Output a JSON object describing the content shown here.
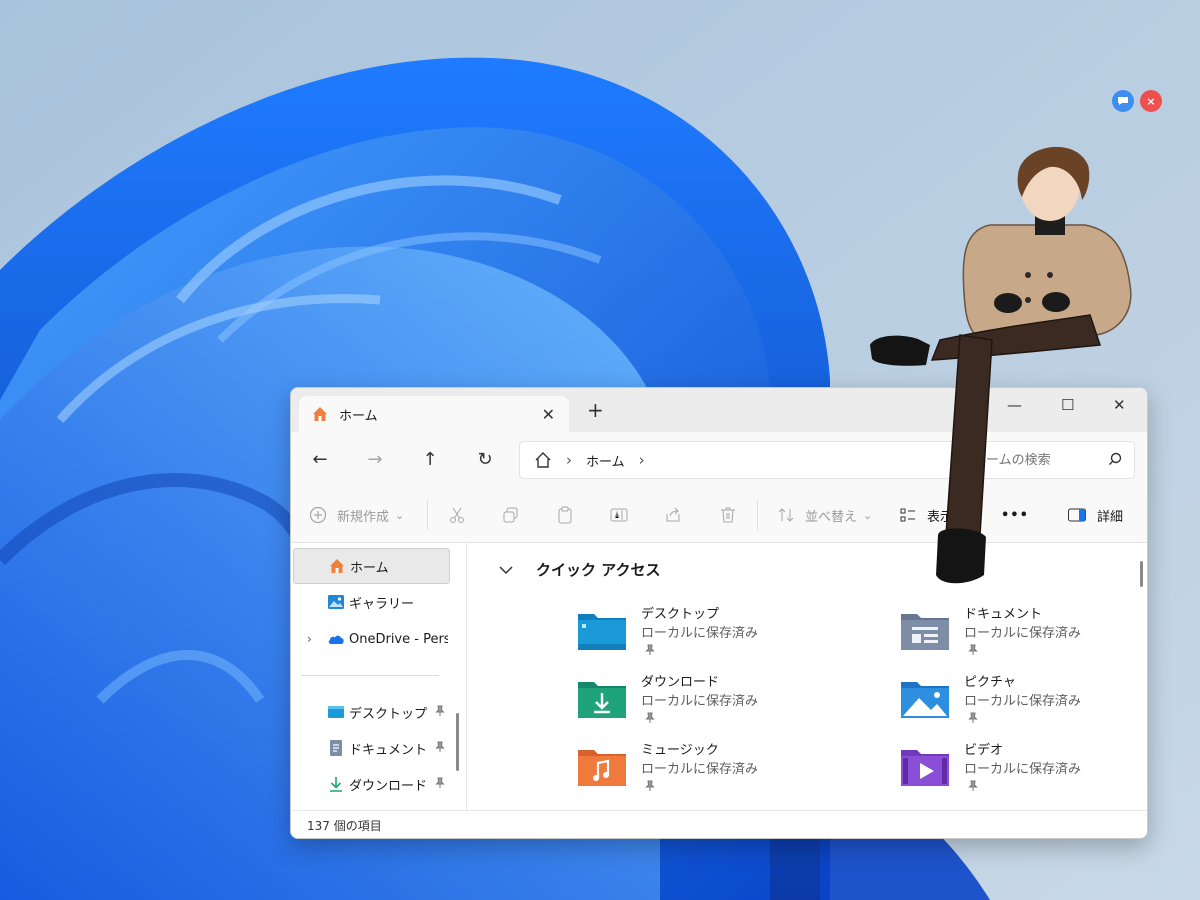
{
  "colors": {
    "accent_home": "#f0803c",
    "folder_blue": "#1a9bd7",
    "folder_green": "#1fa37a",
    "folder_orange": "#ef7a3c",
    "folder_purple": "#8a4fd6",
    "folder_gray": "#7d8ea6",
    "folder_sky": "#2e8fe0"
  },
  "mascot": {
    "chat_icon": "chat-bubble-icon",
    "close_glyph": "×"
  },
  "window": {
    "tab_title": "ホーム",
    "tab_close": "✕",
    "new_tab": "+",
    "minimize": "—",
    "maximize": "☐",
    "close": "✕"
  },
  "nav": {
    "back": "←",
    "forward": "→",
    "up": "↑",
    "refresh": "↻",
    "breadcrumb": "ホーム",
    "sep": "›",
    "search_placeholder": "ームの検索"
  },
  "toolbar": {
    "new": "新規作成",
    "new_caret": "⌄",
    "sort": "並べ替え",
    "sort_caret": "⌄",
    "view": "表示",
    "more": "•••",
    "details": "詳細"
  },
  "sidebar": {
    "items": [
      {
        "label": "ホーム",
        "icon": "home-icon",
        "selected": true
      },
      {
        "label": "ギャラリー",
        "icon": "gallery-icon"
      },
      {
        "label": "OneDrive - Perso",
        "icon": "onedrive-icon",
        "expander": "›"
      },
      {
        "label": "デスクトップ",
        "icon": "desktop-icon",
        "pinned": true
      },
      {
        "label": "ドキュメント",
        "icon": "documents-icon",
        "pinned": true
      },
      {
        "label": "ダウンロード",
        "icon": "download-icon",
        "pinned": true
      }
    ]
  },
  "quick_access": {
    "title": "クイック アクセス",
    "items": [
      {
        "name": "デスクトップ",
        "sub": "ローカルに保存済み",
        "icon": "desktop-folder-icon"
      },
      {
        "name": "ドキュメント",
        "sub": "ローカルに保存済み",
        "icon": "documents-folder-icon"
      },
      {
        "name": "ダウンロード",
        "sub": "ローカルに保存済み",
        "icon": "downloads-folder-icon"
      },
      {
        "name": "ピクチャ",
        "sub": "ローカルに保存済み",
        "icon": "pictures-folder-icon"
      },
      {
        "name": "ミュージック",
        "sub": "ローカルに保存済み",
        "icon": "music-folder-icon"
      },
      {
        "name": "ビデオ",
        "sub": "ローカルに保存済み",
        "icon": "videos-folder-icon"
      }
    ]
  },
  "status": {
    "count": "137 個の項目"
  }
}
